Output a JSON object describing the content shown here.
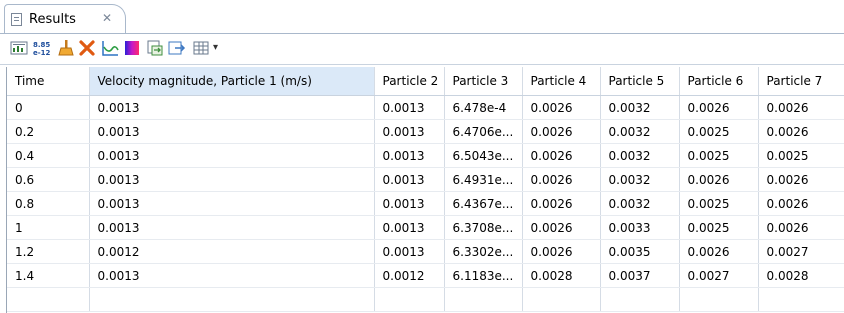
{
  "tab": {
    "label": "Results",
    "close_glyph": "✕"
  },
  "toolbar": {
    "icons": [
      "table-view-icon",
      "number-format-icon",
      "clear-icon",
      "delete-icon",
      "plot-icon",
      "color-table-icon",
      "export-icon",
      "export-to-file-icon",
      "table-settings-icon"
    ],
    "number_format_top": "8.85",
    "number_format_bottom": "e-12",
    "dropdown_glyph": "▾"
  },
  "table": {
    "columns": [
      "Time",
      "Velocity magnitude, Particle 1 (m/s)",
      "Particle 2",
      "Particle 3",
      "Particle 4",
      "Particle 5",
      "Particle 6",
      "Particle 7"
    ],
    "rows": [
      [
        "0",
        "0.0013",
        "0.0013",
        "6.478e-4",
        "0.0026",
        "0.0032",
        "0.0026",
        "0.0026"
      ],
      [
        "0.2",
        "0.0013",
        "0.0013",
        "6.4706e...",
        "0.0026",
        "0.0032",
        "0.0025",
        "0.0026"
      ],
      [
        "0.4",
        "0.0013",
        "0.0013",
        "6.5043e...",
        "0.0026",
        "0.0032",
        "0.0025",
        "0.0025"
      ],
      [
        "0.6",
        "0.0013",
        "0.0013",
        "6.4931e...",
        "0.0026",
        "0.0032",
        "0.0026",
        "0.0026"
      ],
      [
        "0.8",
        "0.0013",
        "0.0013",
        "6.4367e...",
        "0.0026",
        "0.0032",
        "0.0025",
        "0.0026"
      ],
      [
        "1",
        "0.0013",
        "0.0013",
        "6.3708e...",
        "0.0026",
        "0.0033",
        "0.0025",
        "0.0026"
      ],
      [
        "1.2",
        "0.0012",
        "0.0013",
        "6.3302e...",
        "0.0026",
        "0.0035",
        "0.0026",
        "0.0027"
      ],
      [
        "1.4",
        "0.0013",
        "0.0012",
        "6.1183e...",
        "0.0028",
        "0.0037",
        "0.0027",
        "0.0028"
      ]
    ]
  }
}
